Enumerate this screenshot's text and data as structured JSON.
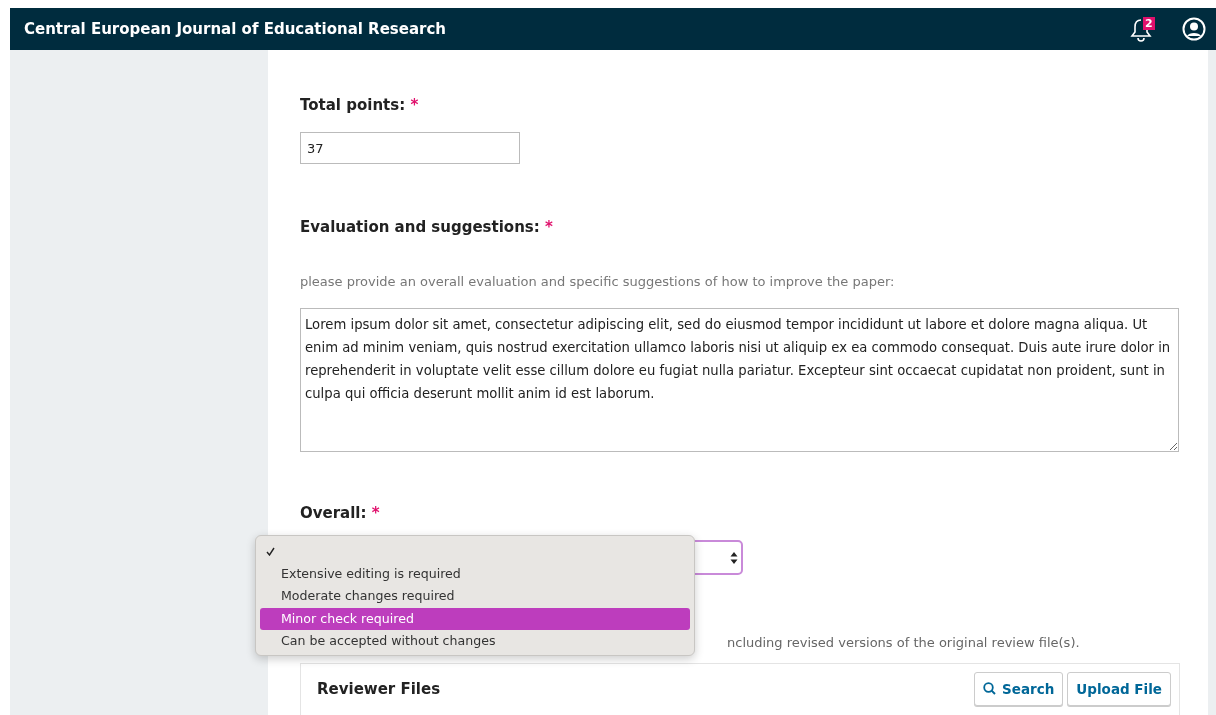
{
  "header": {
    "title": "Central European Journal of Educational Research",
    "notification_count": "2"
  },
  "form": {
    "total_points": {
      "label": "Total points:",
      "required_mark": "*",
      "value": "37"
    },
    "evaluation": {
      "label": "Evaluation and suggestions:",
      "required_mark": "*",
      "hint": "please provide an overall evaluation and specific suggestions of how to improve the paper:",
      "value": "Lorem ipsum dolor sit amet, consectetur adipiscing elit, sed do eiusmod tempor incididunt ut labore et dolore magna aliqua. Ut enim ad minim veniam, quis nostrud exercitation ullamco laboris nisi ut aliquip ex ea commodo consequat. Duis aute irure dolor in reprehenderit in voluptate velit esse cillum dolore eu fugiat nulla pariatur. Excepteur sint occaecat cupidatat non proident, sunt in culpa qui officia deserunt mollit anim id est laborum."
    },
    "overall": {
      "label": "Overall:",
      "required_mark": "*",
      "options": [
        {
          "checked": true,
          "selected": false
        },
        {
          "label": "Extensive editing is required",
          "checked": false,
          "selected": false
        },
        {
          "label": "Moderate changes required",
          "checked": false,
          "selected": false
        },
        {
          "label": "Minor check required",
          "checked": false,
          "selected": true
        },
        {
          "label": "Can be accepted without changes",
          "checked": false,
          "selected": false
        }
      ]
    },
    "files_note": "ncluding revised versions of the original review file(s).",
    "reviewer_files": {
      "title": "Reviewer Files",
      "buttons": [
        {
          "label": "Search",
          "kind": "search"
        },
        {
          "label": "Upload File",
          "kind": "plain"
        }
      ]
    }
  }
}
